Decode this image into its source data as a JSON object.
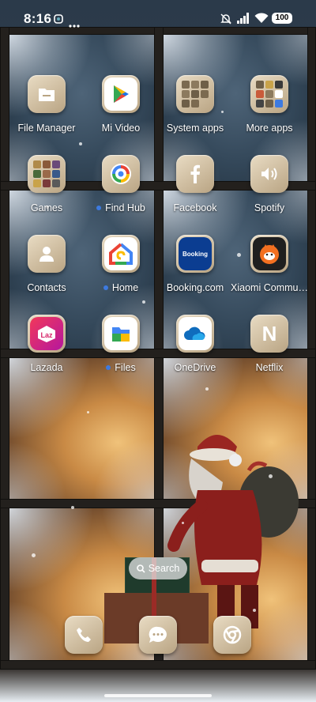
{
  "status_bar": {
    "time": "8:16",
    "battery": "100",
    "icons": [
      "app-notification-icon",
      "more-dots-icon",
      "mute-icon",
      "signal-icon",
      "wifi-icon",
      "battery-icon"
    ]
  },
  "apps": [
    {
      "label": "File Manager",
      "icon": "file-manager-icon"
    },
    {
      "label": "Mi Video",
      "icon": "mi-video-icon"
    },
    {
      "label": "System apps",
      "icon": "folder-icon"
    },
    {
      "label": "More apps",
      "icon": "folder-icon"
    },
    {
      "label": "Games",
      "icon": "folder-icon"
    },
    {
      "label": "Find Hub",
      "icon": "find-hub-icon",
      "new_dot": true
    },
    {
      "label": "Facebook",
      "icon": "facebook-icon"
    },
    {
      "label": "Spotify",
      "icon": "spotify-icon"
    },
    {
      "label": "Contacts",
      "icon": "contacts-icon"
    },
    {
      "label": "Home",
      "icon": "google-home-icon",
      "new_dot": true
    },
    {
      "label": "Booking.com",
      "icon": "booking-icon",
      "icon_text": "Booking"
    },
    {
      "label": "Xiaomi Commu…",
      "icon": "xiaomi-community-icon"
    },
    {
      "label": "Lazada",
      "icon": "lazada-icon",
      "icon_text": "Laz"
    },
    {
      "label": "Files",
      "icon": "files-icon",
      "new_dot": true
    },
    {
      "label": "OneDrive",
      "icon": "onedrive-icon"
    },
    {
      "label": "Netflix",
      "icon": "netflix-icon",
      "icon_text": "N"
    }
  ],
  "search": {
    "label": "Search"
  },
  "dock": [
    {
      "icon": "phone-icon"
    },
    {
      "icon": "messages-icon"
    },
    {
      "icon": "chrome-icon"
    }
  ],
  "colors": {
    "accent_dot": "#3d7ae0",
    "tile": "#d6c6a8",
    "frame": "#23201d"
  }
}
